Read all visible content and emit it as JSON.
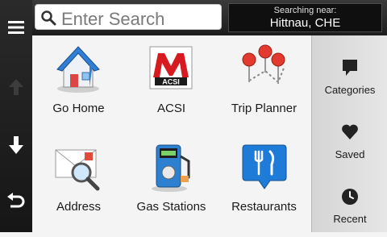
{
  "search": {
    "placeholder": "Enter Search"
  },
  "searching_near": {
    "label": "Searching near:",
    "value": "Hittnau, CHE"
  },
  "categories": [
    {
      "label": "Go Home",
      "icon": "house-icon"
    },
    {
      "label": "ACSI",
      "icon": "acsi-logo-icon",
      "logo_text": "ACSI"
    },
    {
      "label": "Trip Planner",
      "icon": "trip-planner-pins-icon"
    },
    {
      "label": "Address",
      "icon": "address-envelope-icon"
    },
    {
      "label": "Gas Stations",
      "icon": "fuel-pump-icon"
    },
    {
      "label": "Restaurants",
      "icon": "restaurant-icon"
    }
  ],
  "side_menu": [
    {
      "label": "Categories",
      "icon": "speech-bubble-icon"
    },
    {
      "label": "Saved",
      "icon": "heart-icon"
    },
    {
      "label": "Recent",
      "icon": "clock-icon"
    }
  ],
  "colors": {
    "rail": "#1c1c1c",
    "header": "#2a2a2a",
    "house_blue": "#2f7fd6",
    "acsi_red": "#d71920",
    "pin_red": "#e23a2e",
    "gas_blue": "#2d7fd0",
    "restaurant_blue": "#1f7bd8"
  }
}
